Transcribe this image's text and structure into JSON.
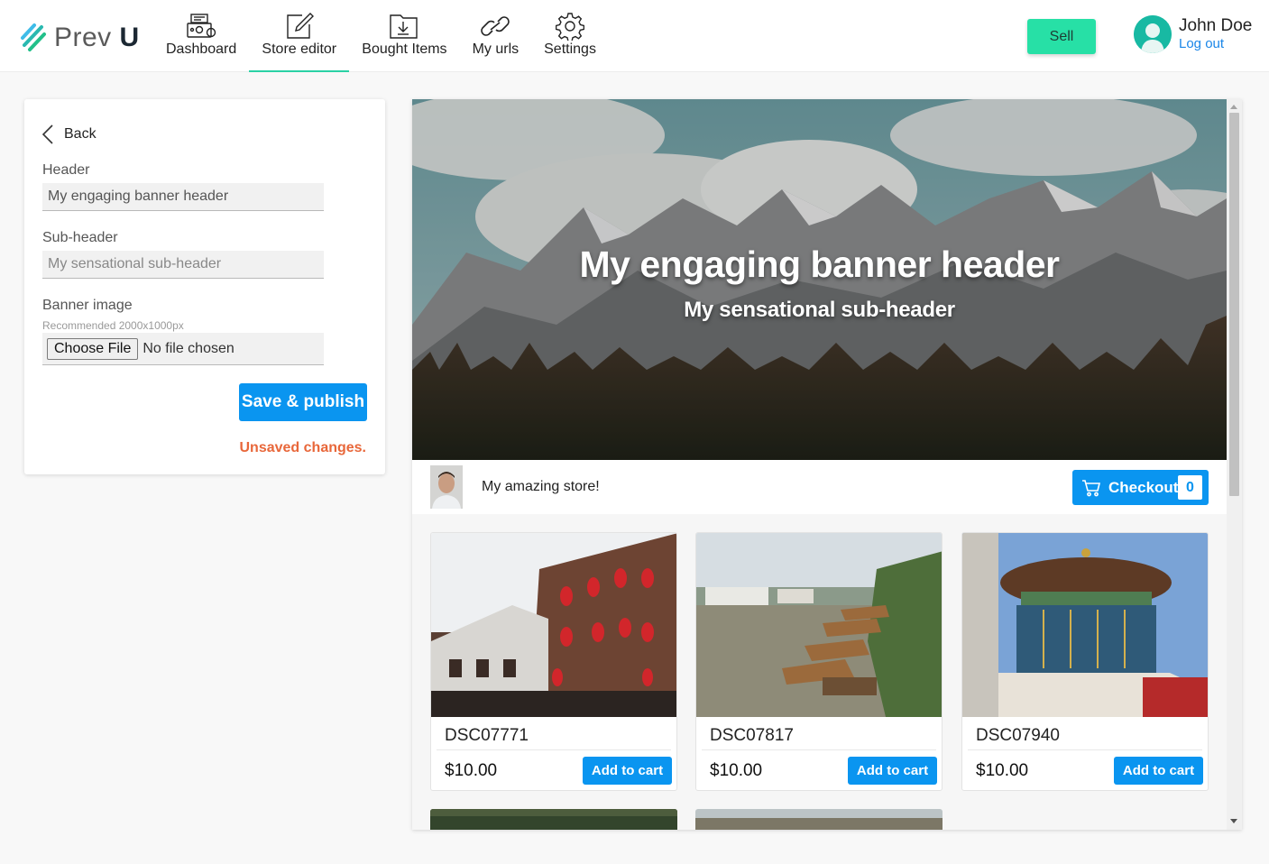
{
  "app": {
    "logo_text_light": "Prev",
    "logo_text_bold": "U"
  },
  "nav": {
    "items": [
      {
        "label": "Dashboard",
        "icon": "cash-register-icon"
      },
      {
        "label": "Store editor",
        "icon": "edit-icon",
        "active": true
      },
      {
        "label": "Bought Items",
        "icon": "download-folder-icon"
      },
      {
        "label": "My urls",
        "icon": "link-icon"
      },
      {
        "label": "Settings",
        "icon": "gear-icon"
      }
    ]
  },
  "header": {
    "sell_label": "Sell",
    "user_name": "John Doe",
    "logout_label": "Log out"
  },
  "editor": {
    "back_label": "Back",
    "header_label": "Header",
    "header_value": "My engaging banner header",
    "subheader_label": "Sub-header",
    "subheader_placeholder": "My sensational sub-header",
    "banner_label": "Banner image",
    "banner_hint": "Recommended 2000x1000px",
    "choose_file_label": "Choose File",
    "file_status": "No file chosen",
    "save_label": "Save & publish",
    "unsaved_label": "Unsaved changes."
  },
  "preview": {
    "banner_title": "My engaging banner header",
    "banner_subtitle": "My sensational sub-header",
    "store_name": "My amazing store!",
    "checkout_label": "Checkout",
    "cart_count": "0",
    "products": [
      {
        "title": "DSC07771",
        "price": "$10.00",
        "button": "Add to cart"
      },
      {
        "title": "DSC07817",
        "price": "$10.00",
        "button": "Add to cart"
      },
      {
        "title": "DSC07940",
        "price": "$10.00",
        "button": "Add to cart"
      }
    ]
  },
  "colors": {
    "accent": "#27e0a6",
    "primary": "#0a95f0",
    "warning": "#e8673a",
    "link": "#1a86e8"
  }
}
